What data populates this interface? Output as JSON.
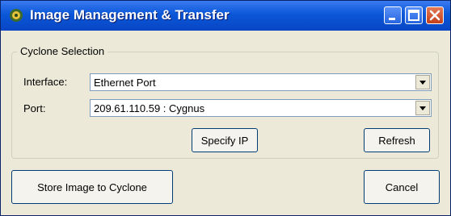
{
  "window": {
    "title": "Image Management & Transfer",
    "icons": [
      "app-icon",
      "minimize-icon",
      "maximize-icon",
      "close-icon"
    ]
  },
  "cyclone_selection": {
    "group_label": "Cyclone Selection",
    "interface_label": "Interface:",
    "interface_value": "Ethernet Port",
    "port_label": "Port:",
    "port_value": "209.61.110.59  :  Cygnus",
    "specify_ip_button": "Specify IP",
    "refresh_button": "Refresh"
  },
  "footer": {
    "store_button": "Store Image to  Cyclone",
    "cancel_button": "Cancel"
  }
}
